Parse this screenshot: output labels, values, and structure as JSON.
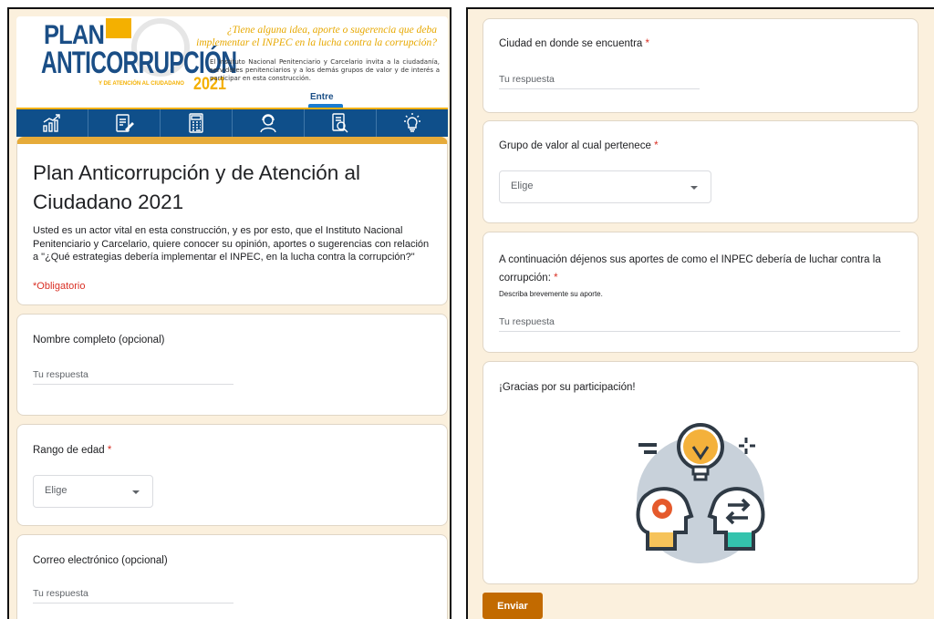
{
  "banner": {
    "logo_line1": "PLAN",
    "logo_line2": "ANTICORRUPCIÓN",
    "logo_subline": "Y DE ATENCIÓN AL CIUDADANO",
    "logo_year": "2021",
    "tagline": "¿Tiene alguna idea, aporte o sugerencia que deba implementar el INPEC en la lucha contra la corrupción?",
    "invite_text": "El Instituto Nacional Penitenciario y Carcelario invita a la ciudadanía, servidores penitenciarios y a los demás grupos de valor y de interés a participar en esta construcción.",
    "entre_logo": "Entre",
    "strip_icons": [
      "chart-growth-icon",
      "document-pen-icon",
      "calculator-icon",
      "person-headset-icon",
      "document-search-icon",
      "lightbulb-icon"
    ],
    "colors": {
      "strip": "#0f4f8a",
      "accent": "#f4b000",
      "brand": "#1a4e86"
    }
  },
  "form": {
    "title": "Plan Anticorrupción y de Atención al Ciudadano 2021",
    "description": "Usted es un actor vital en esta construcción, y es por esto, que el Instituto Nacional Penitenciario y Carcelario, quiere conocer su opinión, aportes o sugerencias con relación a \"¿Qué estrategias debería implementar el INPEC, en la lucha contra la corrupción?\"",
    "required_note": "*Obligatorio",
    "accent_color": "#e6ab3a"
  },
  "questions": {
    "nombre": {
      "label": "Nombre completo (opcional)",
      "placeholder": "Tu respuesta"
    },
    "edad": {
      "label": "Rango de edad",
      "required_mark": "*",
      "selected": "Elige"
    },
    "correo": {
      "label": "Correo electrónico (opcional)",
      "placeholder": "Tu respuesta"
    },
    "ciudad": {
      "label": "Ciudad en donde se encuentra",
      "required_mark": "*",
      "placeholder": "Tu respuesta"
    },
    "grupo": {
      "label": "Grupo de valor al cual pertenece",
      "required_mark": "*",
      "selected": "Elige"
    },
    "aportes": {
      "label": "A continuación déjenos sus aportes de como el INPEC debería de luchar contra la corrupción:",
      "required_mark": "*",
      "help": "Describa brevemente su aporte.",
      "placeholder": "Tu respuesta"
    }
  },
  "thanks": {
    "text": "¡Gracias por su participación!"
  },
  "submit": {
    "label": "Enviar",
    "color": "#c26a00"
  }
}
